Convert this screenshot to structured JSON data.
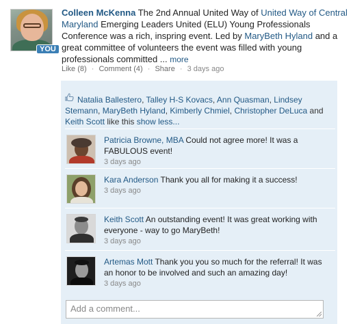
{
  "post": {
    "author": "Colleen McKenna",
    "you_badge": "YOU",
    "text_part1": " The 2nd Annual United Way of ",
    "link_org": "United Way of Central Maryland",
    "text_part2": " Emerging Leaders United (ELU) Young Professionals Conference was a rich, inspring event. Led by ",
    "link_person": "MaryBeth Hyland",
    "text_part3": " and a great committee of volunteers the event was filled with young professionals committed ... ",
    "more_label": "more"
  },
  "meta": {
    "like": "Like (8)",
    "comment": "Comment (4)",
    "share": "Share",
    "time": "3 days ago",
    "sep": "·"
  },
  "likes": {
    "icon": "thumbs-up-icon",
    "names": [
      "Natalia Ballestero",
      "Talley H-S Kovacs",
      "Ann Quasman",
      "Lindsey Stemann",
      "MaryBeth Hyland",
      "Kimberly Chmiel",
      "Christopher DeLuca",
      "Keith Scott"
    ],
    "sep": ", ",
    "and_word": " and ",
    "like_text": " like this ",
    "show_less": "show less..."
  },
  "comments": [
    {
      "name": "Patricia Browne, MBA",
      "text": " Could not agree more! It was a FABULOUS event!",
      "time": "3 days ago"
    },
    {
      "name": "Kara Anderson",
      "text": " Thank you all for making it a success!",
      "time": "3 days ago"
    },
    {
      "name": "Keith Scott",
      "text": " An outstanding event! It was great working with everyone - way to go MaryBeth!",
      "time": "3 days ago"
    },
    {
      "name": "Artemas Mott",
      "text": " Thank you you so much for the referral! It was an honor to be involved and such an amazing day!",
      "time": "3 days ago"
    }
  ],
  "add_comment": {
    "placeholder": "Add a comment..."
  },
  "colors": {
    "link": "#225985",
    "panel": "#e5eff7",
    "badge": "#3b7fb5"
  }
}
